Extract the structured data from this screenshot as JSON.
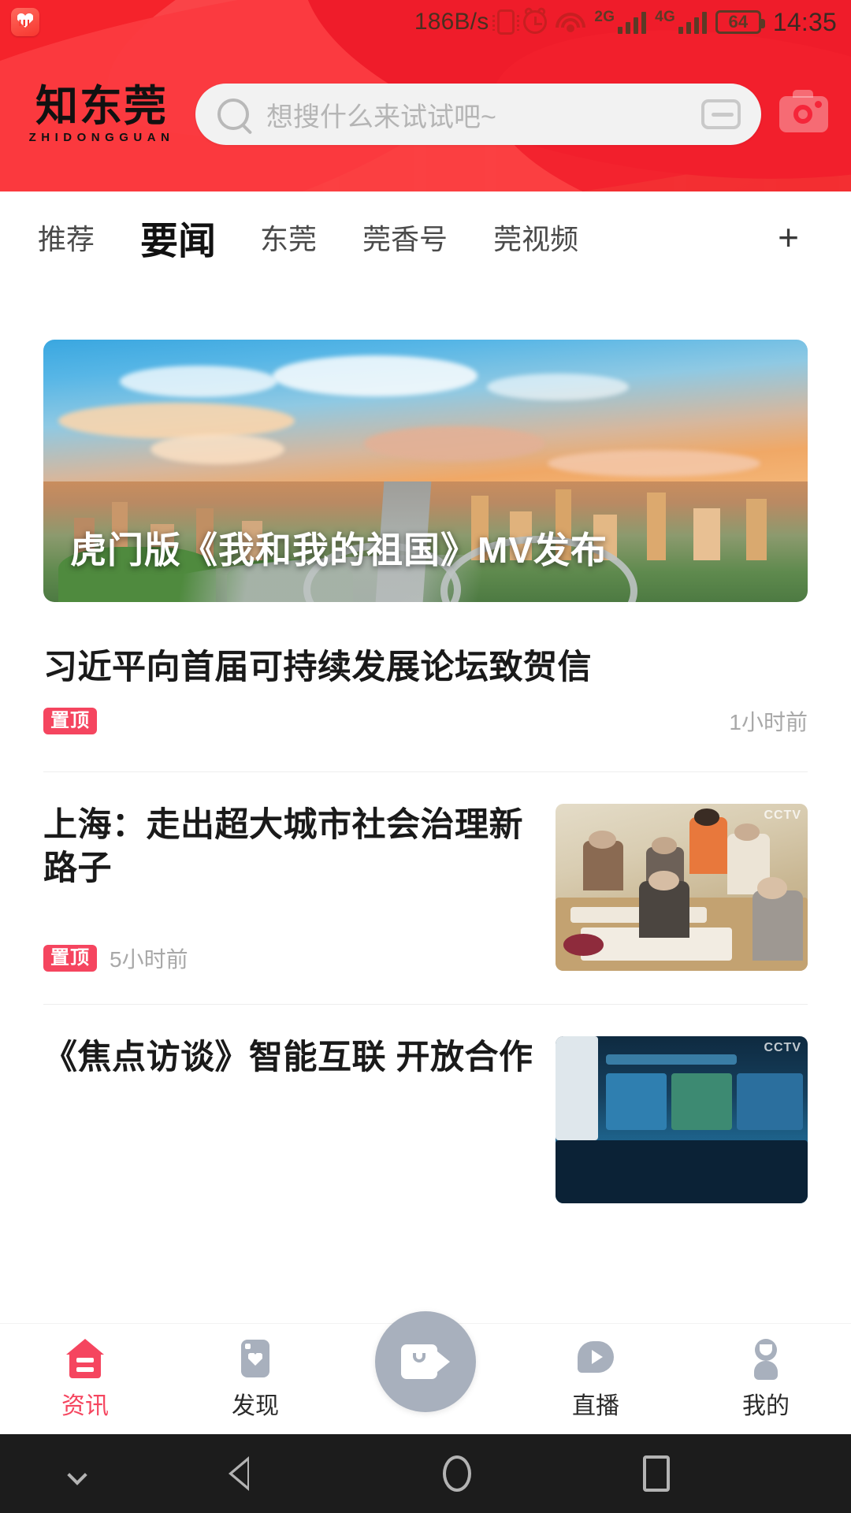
{
  "status_bar": {
    "health_icon": "heart-rate-icon",
    "network_speed": "186B/s",
    "vibrate_icon": "vibrate-icon",
    "alarm_icon": "alarm-clock-icon",
    "wifi_icon": "wifi-icon",
    "sim1_label": "2G",
    "sim2_label": "4G",
    "battery_level": "64",
    "time": "14:35"
  },
  "header": {
    "logo_cn": "知东莞",
    "logo_en": "ZHIDONGGUAN",
    "search_placeholder": "想搜什么来试试吧~",
    "search_value": "",
    "search_icon": "search-icon",
    "scan_icon": "scan-icon",
    "camera_icon": "camera-icon",
    "accent_color": "#f5263a",
    "banner_color": "#fabf76"
  },
  "tabs": {
    "items": [
      {
        "label": "推荐",
        "active": false
      },
      {
        "label": "要闻",
        "active": true
      },
      {
        "label": "东莞",
        "active": false
      },
      {
        "label": "莞香号",
        "active": false
      },
      {
        "label": "莞视频",
        "active": false
      }
    ],
    "add_label": "+"
  },
  "feed": {
    "hero": {
      "title": "虎门版《我和我的祖国》MV发布",
      "image_alt": "城市日落航拍立交桥"
    },
    "items": [
      {
        "title": "习近平向首届可持续发展论坛致贺信",
        "badge": "置顶",
        "time": "1小时前",
        "has_thumb": false,
        "meta_align": "split"
      },
      {
        "title": "上海：走出超大城市社会治理新路子",
        "badge": "置顶",
        "time": "5小时前",
        "has_thumb": true,
        "thumb_alt": "老人书法课堂",
        "meta_align": "left"
      },
      {
        "title": "《焦点访谈》智能互联 开放合作",
        "badge": "",
        "time": "",
        "has_thumb": true,
        "thumb_alt": "大屏幕展览现场",
        "meta_align": "left"
      }
    ]
  },
  "bottom_nav": {
    "items": [
      {
        "label": "资讯",
        "icon": "news-home-icon",
        "active": true
      },
      {
        "label": "发现",
        "icon": "discover-heart-icon",
        "active": false
      },
      {
        "label": "",
        "icon": "video-record-icon",
        "active": false
      },
      {
        "label": "直播",
        "icon": "live-play-icon",
        "active": false
      },
      {
        "label": "我的",
        "icon": "profile-icon",
        "active": false
      }
    ],
    "active_color": "#f5455f",
    "inactive_color": "#a8b0bd"
  },
  "android_nav": {
    "hide_icon": "chevron-down-icon",
    "back_icon": "back-triangle-icon",
    "home_icon": "home-circle-icon",
    "recents_icon": "recents-square-icon"
  }
}
